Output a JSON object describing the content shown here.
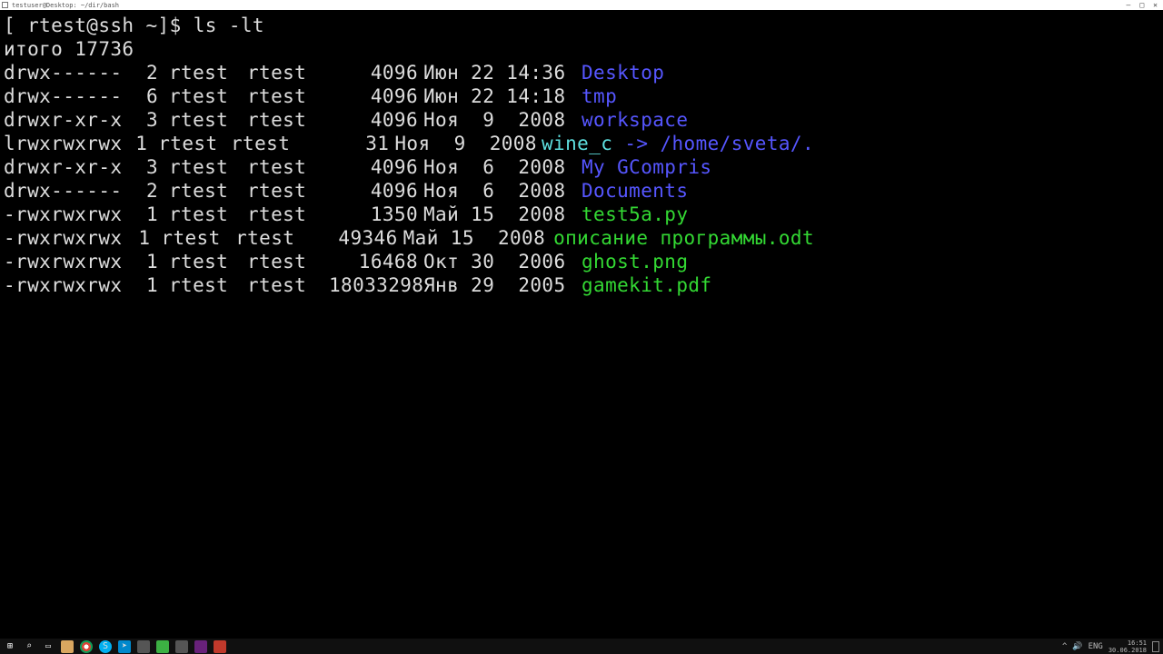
{
  "window": {
    "title": "testuser@Desktop: ~/dir/bash",
    "btn_min": "—",
    "btn_max": "□",
    "btn_close": "✕"
  },
  "prompt": "[ rtest@ssh ~]$ ",
  "command": "ls -lt",
  "total_line": "итого 17736",
  "rows": [
    {
      "perm": "drwx------",
      "links": "2",
      "owner": "rtest",
      "group": "rtest",
      "size": "4096",
      "date": "Июн 22 14:36",
      "name": "Desktop",
      "type": "dir"
    },
    {
      "perm": "drwx------",
      "links": "6",
      "owner": "rtest",
      "group": "rtest",
      "size": "4096",
      "date": "Июн 22 14:18",
      "name": "tmp",
      "type": "dir"
    },
    {
      "perm": "drwxr-xr-x",
      "links": "3",
      "owner": "rtest",
      "group": "rtest",
      "size": "4096",
      "date": "Ноя  9  2008",
      "name": "workspace",
      "type": "dir"
    },
    {
      "perm": "lrwxrwxrwx",
      "links": "1",
      "owner": "rtest",
      "group": "rtest",
      "size": "31",
      "date": "Ноя  9  2008",
      "name": "wine_c",
      "type": "link",
      "target": " -> /home/sveta/."
    },
    {
      "perm": "drwxr-xr-x",
      "links": "3",
      "owner": "rtest",
      "group": "rtest",
      "size": "4096",
      "date": "Ноя  6  2008",
      "name": "My GCompris",
      "type": "dir"
    },
    {
      "perm": "drwx------",
      "links": "2",
      "owner": "rtest",
      "group": "rtest",
      "size": "4096",
      "date": "Ноя  6  2008",
      "name": "Documents",
      "type": "dir"
    },
    {
      "perm": "-rwxrwxrwx",
      "links": "1",
      "owner": "rtest",
      "group": "rtest",
      "size": "1350",
      "date": "Май 15  2008",
      "name": "test5a.py",
      "type": "exec"
    },
    {
      "perm": "-rwxrwxrwx",
      "links": "1",
      "owner": "rtest",
      "group": "rtest",
      "size": "49346",
      "date": "Май 15  2008",
      "name": "описание программы.odt",
      "type": "exec"
    },
    {
      "perm": "-rwxrwxrwx",
      "links": "1",
      "owner": "rtest",
      "group": "rtest",
      "size": "16468",
      "date": "Окт 30  2006",
      "name": "ghost.png",
      "type": "exec"
    },
    {
      "perm": "-rwxrwxrwx",
      "links": "1",
      "owner": "rtest",
      "group": "rtest",
      "size": "18033298",
      "date": "Янв 29  2005",
      "name": "gamekit.pdf",
      "type": "exec"
    }
  ],
  "taskbar": {
    "icons": [
      {
        "name": "start-icon",
        "glyph": "⊞",
        "cls": "start"
      },
      {
        "name": "search-icon",
        "glyph": "⌕",
        "cls": ""
      },
      {
        "name": "taskview-icon",
        "glyph": "▭",
        "cls": ""
      },
      {
        "name": "folder-icon",
        "glyph": "",
        "cls": "folder"
      },
      {
        "name": "chrome-icon",
        "glyph": "",
        "cls": "chrome"
      },
      {
        "name": "skype-icon",
        "glyph": "S",
        "cls": "skype"
      },
      {
        "name": "telegram-icon",
        "glyph": "➤",
        "cls": "telegram"
      },
      {
        "name": "app-icon-1",
        "glyph": "",
        "cls": "grey"
      },
      {
        "name": "app-icon-2",
        "glyph": "",
        "cls": "green"
      },
      {
        "name": "app-icon-3",
        "glyph": "",
        "cls": "grey"
      },
      {
        "name": "vs-icon",
        "glyph": "",
        "cls": "vs"
      },
      {
        "name": "app-icon-4",
        "glyph": "",
        "cls": "red"
      }
    ],
    "tray_up": "^",
    "tray_vol": "🔊",
    "tray_lang": "ENG",
    "tray_time": "16:51",
    "tray_date": "30.06.2018"
  }
}
